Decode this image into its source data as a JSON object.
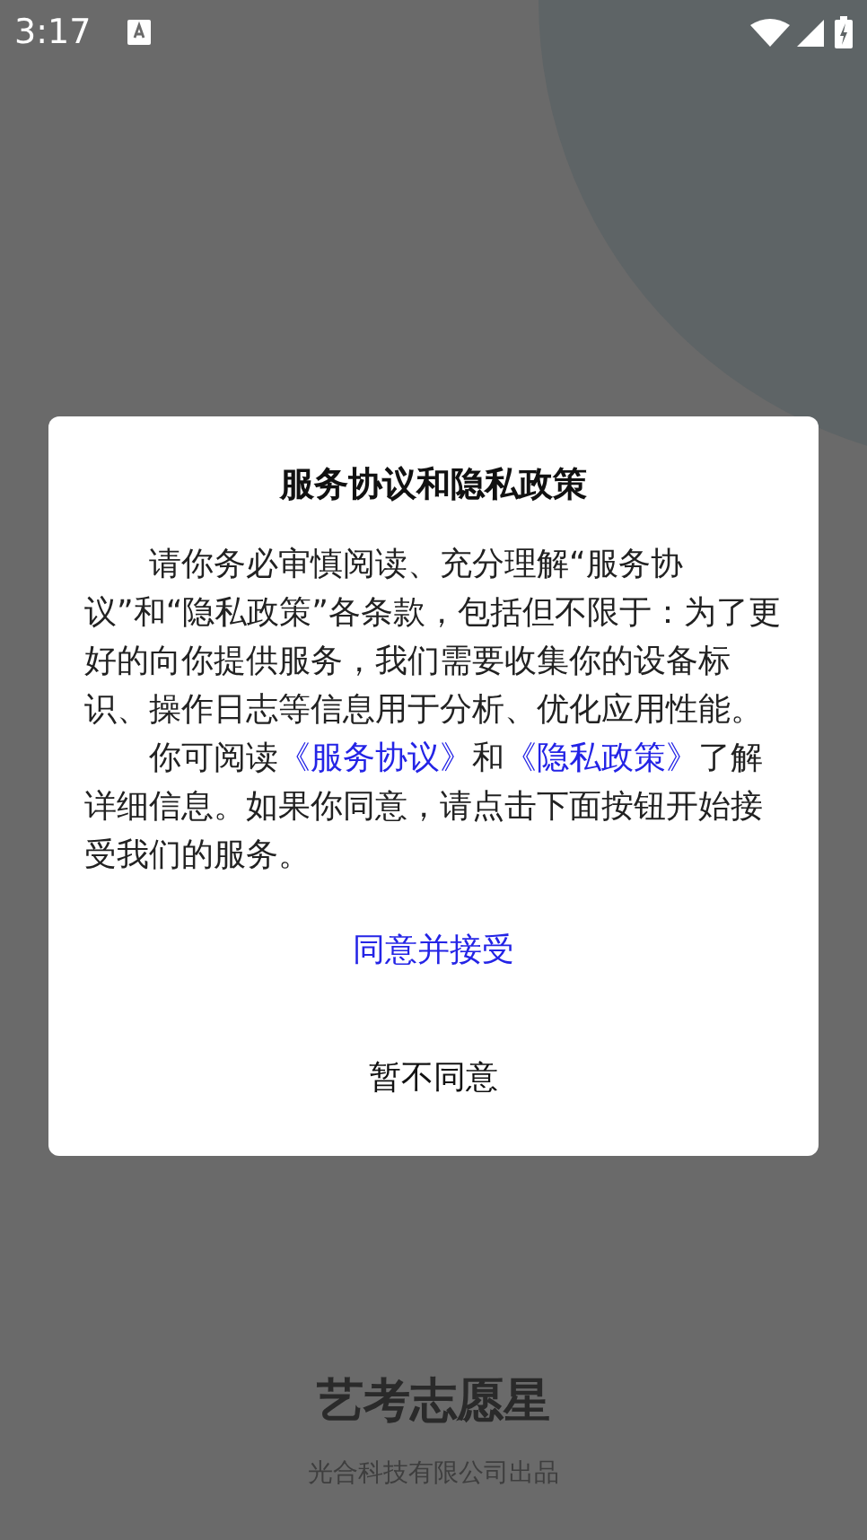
{
  "status_bar": {
    "time": "3:17"
  },
  "dialog": {
    "title": "服务协议和隐私政策",
    "paragraphs": [
      [
        {
          "kind": "text",
          "text": "请你务必审慎阅读、充分理解“服务协议”和“隐私政策”各条款，包括但不限于：为了更好的向你提供服务，我们需要收集你的设备标识、操作日志等信息用于分析、优化应用性能。"
        }
      ],
      [
        {
          "kind": "text",
          "text": "你可阅读"
        },
        {
          "kind": "link",
          "text": "《服务协议》"
        },
        {
          "kind": "text",
          "text": "和"
        },
        {
          "kind": "link",
          "text": "《隐私政策》"
        },
        {
          "kind": "text",
          "text": "了解详细信息。如果你同意，请点击下面按钮开始接受我们的服务。"
        }
      ]
    ],
    "buttons": [
      {
        "kind": "primary",
        "label": "同意并接受"
      },
      {
        "kind": "secondary",
        "label": "暂不同意"
      }
    ]
  },
  "app": {
    "name": "艺考志愿星",
    "company": "光合科技有限公司出品"
  }
}
